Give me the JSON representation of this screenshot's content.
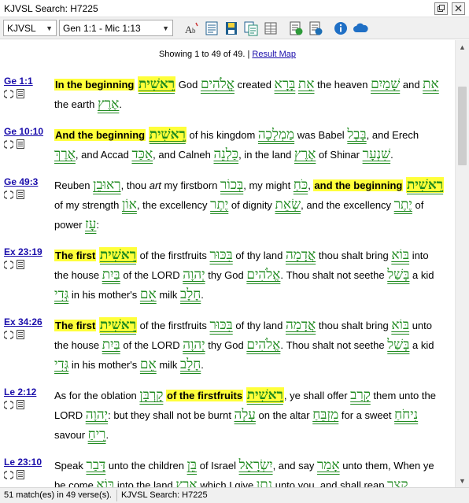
{
  "window": {
    "title": "KJVSL Search: H7225"
  },
  "toolbar": {
    "version": "KJVSL",
    "range": "Gen 1:1 - Mic 1:13"
  },
  "results": {
    "showing": "Showing 1 to 49 of 49.",
    "result_map": "Result Map"
  },
  "status": {
    "matches": "51 match(es) in 49 verse(s).",
    "search": "KJVSL Search: H7225"
  },
  "colors": {
    "highlight": "#ffff3a",
    "hebrew": "#1f8a1f",
    "link": "#1a0dab"
  },
  "verses": [
    {
      "ref": "Ge 1:1",
      "segments": [
        {
          "t": "In the beginning",
          "s": "hl"
        },
        {
          "t": " "
        },
        {
          "t": "רֵאשִׁית",
          "s": "heb-hl"
        },
        {
          "t": " God "
        },
        {
          "t": "אֱלֹהִים",
          "s": "heb"
        },
        {
          "t": " created "
        },
        {
          "t": "אֵת",
          "s": "heb"
        },
        {
          "t": " "
        },
        {
          "t": "בָּרָא",
          "s": "heb"
        },
        {
          "t": " the heaven "
        },
        {
          "t": "שָׁמַיִם",
          "s": "heb"
        },
        {
          "t": " and "
        },
        {
          "t": "אֵת",
          "s": "heb"
        },
        {
          "t": " the earth "
        },
        {
          "t": "אֶרֶץ",
          "s": "heb"
        },
        {
          "t": "."
        }
      ]
    },
    {
      "ref": "Ge 10:10",
      "segments": [
        {
          "t": "And the beginning",
          "s": "hl"
        },
        {
          "t": " "
        },
        {
          "t": "רֵאשִׁית",
          "s": "heb-hl"
        },
        {
          "t": " of his kingdom "
        },
        {
          "t": "מַמְלָכָה",
          "s": "heb"
        },
        {
          "t": " was Babel "
        },
        {
          "t": "בָּבֶל",
          "s": "heb"
        },
        {
          "t": ", and Erech "
        },
        {
          "t": "אֶרֶךְ",
          "s": "heb"
        },
        {
          "t": ", and Accad "
        },
        {
          "t": "אַכַּד",
          "s": "heb"
        },
        {
          "t": ", and Calneh "
        },
        {
          "t": "כַּלְנֵה",
          "s": "heb"
        },
        {
          "t": ", in the land "
        },
        {
          "t": "אֶרֶץ",
          "s": "heb"
        },
        {
          "t": " of Shinar "
        },
        {
          "t": "שִׁנְעָר",
          "s": "heb"
        },
        {
          "t": "."
        }
      ]
    },
    {
      "ref": "Ge 49:3",
      "segments": [
        {
          "t": "Reuben "
        },
        {
          "t": "רְאוּבֵן",
          "s": "heb"
        },
        {
          "t": ", thou "
        },
        {
          "t": "art",
          "s": "it"
        },
        {
          "t": " my firstborn "
        },
        {
          "t": "בְּכוֹר",
          "s": "heb"
        },
        {
          "t": ", my might "
        },
        {
          "t": "כֹּחַ",
          "s": "heb"
        },
        {
          "t": ", "
        },
        {
          "t": "and the beginning",
          "s": "hl"
        },
        {
          "t": " "
        },
        {
          "t": "רֵאשִׁית",
          "s": "heb-hl"
        },
        {
          "t": " of my strength "
        },
        {
          "t": "אוֹן",
          "s": "heb"
        },
        {
          "t": ", the excellency "
        },
        {
          "t": "יֶתֶר",
          "s": "heb"
        },
        {
          "t": " of dignity "
        },
        {
          "t": "שְׂאֵת",
          "s": "heb"
        },
        {
          "t": ", and the excellency "
        },
        {
          "t": "יֶתֶר",
          "s": "heb"
        },
        {
          "t": " of power "
        },
        {
          "t": "עָז",
          "s": "heb"
        },
        {
          "t": ":"
        }
      ]
    },
    {
      "ref": "Ex 23:19",
      "segments": [
        {
          "t": "The first",
          "s": "hl"
        },
        {
          "t": " "
        },
        {
          "t": "רֵאשִׁית",
          "s": "heb-hl"
        },
        {
          "t": " of the firstfruits "
        },
        {
          "t": "בִּכּוּר",
          "s": "heb"
        },
        {
          "t": " of thy land "
        },
        {
          "t": "אֲדָמָה",
          "s": "heb"
        },
        {
          "t": " thou shalt bring "
        },
        {
          "t": "בּוֹא",
          "s": "heb"
        },
        {
          "t": " into the house "
        },
        {
          "t": "בַּיִת",
          "s": "heb"
        },
        {
          "t": " of the LORD "
        },
        {
          "t": "יְהוָה",
          "s": "heb"
        },
        {
          "t": " thy God "
        },
        {
          "t": "אֱלֹהִים",
          "s": "heb"
        },
        {
          "t": ". Thou shalt not seethe "
        },
        {
          "t": "בָּשַׁל",
          "s": "heb"
        },
        {
          "t": " a kid "
        },
        {
          "t": "גְּדִי",
          "s": "heb"
        },
        {
          "t": " in his mother's "
        },
        {
          "t": "אֵם",
          "s": "heb"
        },
        {
          "t": " milk "
        },
        {
          "t": "חָלָב",
          "s": "heb"
        },
        {
          "t": "."
        }
      ]
    },
    {
      "ref": "Ex 34:26",
      "segments": [
        {
          "t": "The first",
          "s": "hl"
        },
        {
          "t": " "
        },
        {
          "t": "רֵאשִׁית",
          "s": "heb-hl"
        },
        {
          "t": " of the firstfruits "
        },
        {
          "t": "בִּכּוּר",
          "s": "heb"
        },
        {
          "t": " of thy land "
        },
        {
          "t": "אֲדָמָה",
          "s": "heb"
        },
        {
          "t": " thou shalt bring "
        },
        {
          "t": "בּוֹא",
          "s": "heb"
        },
        {
          "t": " unto the house "
        },
        {
          "t": "בַּיִת",
          "s": "heb"
        },
        {
          "t": " of the LORD "
        },
        {
          "t": "יְהוָה",
          "s": "heb"
        },
        {
          "t": " thy God "
        },
        {
          "t": "אֱלֹהִים",
          "s": "heb"
        },
        {
          "t": ". Thou shalt not seethe "
        },
        {
          "t": "בָּשַׁל",
          "s": "heb"
        },
        {
          "t": " a kid "
        },
        {
          "t": "גְּדִי",
          "s": "heb"
        },
        {
          "t": " in his mother's "
        },
        {
          "t": "אֵם",
          "s": "heb"
        },
        {
          "t": " milk "
        },
        {
          "t": "חָלָב",
          "s": "heb"
        },
        {
          "t": "."
        }
      ]
    },
    {
      "ref": "Le 2:12",
      "segments": [
        {
          "t": "As for the oblation "
        },
        {
          "t": "קָרְבָּן",
          "s": "heb"
        },
        {
          "t": " "
        },
        {
          "t": "of the firstfruits",
          "s": "hl"
        },
        {
          "t": " "
        },
        {
          "t": "רֵאשִׁית",
          "s": "heb-hl"
        },
        {
          "t": ", ye shall offer "
        },
        {
          "t": "קָרַב",
          "s": "heb"
        },
        {
          "t": " them unto the LORD "
        },
        {
          "t": "יְהוָה",
          "s": "heb"
        },
        {
          "t": ": but they shall not be burnt "
        },
        {
          "t": "עָלָה",
          "s": "heb"
        },
        {
          "t": " on the altar "
        },
        {
          "t": "מִזְבֵּחַ",
          "s": "heb"
        },
        {
          "t": " for a sweet "
        },
        {
          "t": "נִיחֹחַ",
          "s": "heb"
        },
        {
          "t": " savour "
        },
        {
          "t": "רֵיחַ",
          "s": "heb"
        },
        {
          "t": "."
        }
      ]
    },
    {
      "ref": "Le 23:10",
      "segments": [
        {
          "t": "Speak "
        },
        {
          "t": "דָּבַר",
          "s": "heb"
        },
        {
          "t": " unto the children "
        },
        {
          "t": "בֵּן",
          "s": "heb"
        },
        {
          "t": " of Israel "
        },
        {
          "t": "יִשְׂרָאֵל",
          "s": "heb"
        },
        {
          "t": ", and say "
        },
        {
          "t": "אָמַר",
          "s": "heb"
        },
        {
          "t": " unto them, When ye be come "
        },
        {
          "t": "בּוֹא",
          "s": "heb"
        },
        {
          "t": " into the land "
        },
        {
          "t": "אֶרֶץ",
          "s": "heb"
        },
        {
          "t": " which I give "
        },
        {
          "t": "נָתַן",
          "s": "heb"
        },
        {
          "t": " unto you, and shall reap "
        },
        {
          "t": "קָצַר",
          "s": "heb"
        }
      ]
    }
  ]
}
